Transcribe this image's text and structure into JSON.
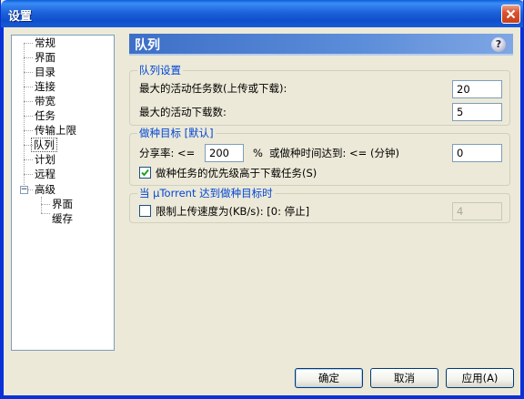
{
  "window": {
    "title": "设置"
  },
  "tree": {
    "items": [
      {
        "label": "常规"
      },
      {
        "label": "界面"
      },
      {
        "label": "目录"
      },
      {
        "label": "连接"
      },
      {
        "label": "带宽"
      },
      {
        "label": "任务"
      },
      {
        "label": "传输上限"
      },
      {
        "label": "队列",
        "selected": true
      },
      {
        "label": "计划"
      },
      {
        "label": "远程"
      },
      {
        "label": "高级",
        "expanded": true
      },
      {
        "label": "界面"
      },
      {
        "label": "缓存"
      }
    ]
  },
  "panel": {
    "title": "队列",
    "help_icon": "help-icon"
  },
  "queue_settings": {
    "legend": "队列设置",
    "max_active_label": "最大的活动任务数(上传或下载):",
    "max_active_value": "20",
    "max_downloads_label": "最大的活动下载数:",
    "max_downloads_value": "5"
  },
  "seeding_goal": {
    "legend": "做种目标 [默认]",
    "ratio_label": "分享率: <=",
    "ratio_value": "200",
    "percent_label": "%",
    "time_label": "或做种时间达到: <= (分钟)",
    "time_value": "0",
    "priority_label": "做种任务的优先级高于下载任务(S)",
    "priority_checked": true
  },
  "goal_reached": {
    "legend": "当 µTorrent 达到做种目标时",
    "limit_label": "限制上传速度为(KB/s): [0: 停止]",
    "limit_checked": false,
    "limit_value": "4"
  },
  "buttons": {
    "ok": "确定",
    "cancel": "取消",
    "apply": "应用(A)"
  },
  "colors": {
    "accent": "#0046D5",
    "titlebar": "#0A5FD8",
    "panel_header": "#3D6FC7"
  }
}
